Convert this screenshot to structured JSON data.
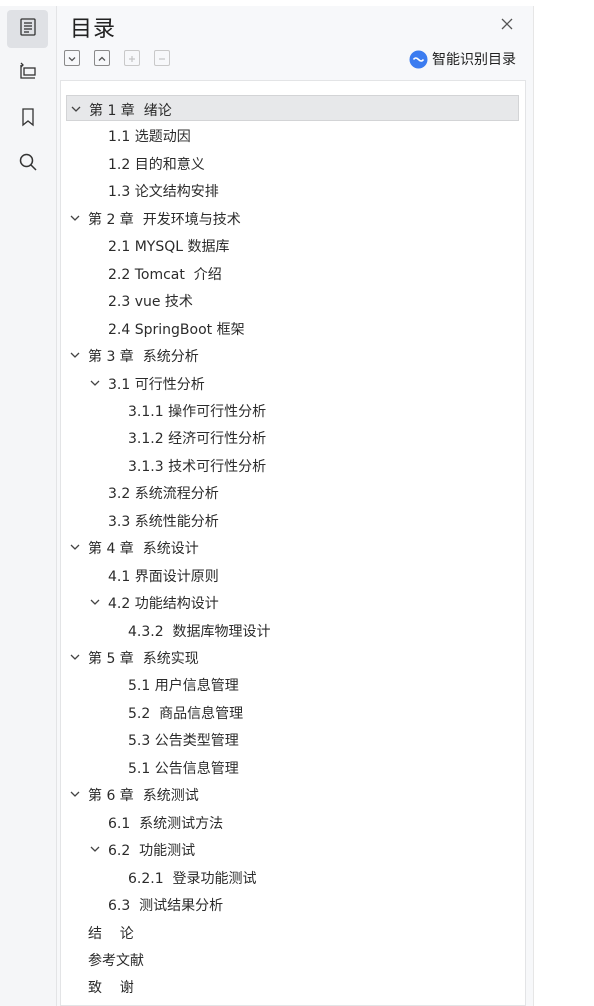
{
  "panel": {
    "title": "目录",
    "smart_button_label": "智能识别目录"
  },
  "rail": {
    "items": [
      {
        "icon": "outline-icon",
        "active": true
      },
      {
        "icon": "layers-icon",
        "active": false
      },
      {
        "icon": "bookmark-icon",
        "active": false
      },
      {
        "icon": "search-icon",
        "active": false
      }
    ]
  },
  "toolbar": {
    "buttons": [
      {
        "icon": "collapse-down-icon",
        "enabled": true
      },
      {
        "icon": "collapse-up-icon",
        "enabled": true
      },
      {
        "icon": "plus-icon",
        "enabled": false
      },
      {
        "icon": "minus-icon",
        "enabled": false
      }
    ]
  },
  "toc": {
    "items": [
      {
        "label": "第 1 章  绪论",
        "level": 1,
        "expanded": true,
        "selected": true
      },
      {
        "label": "1.1 选题动因",
        "level": 2
      },
      {
        "label": "1.2 目的和意义",
        "level": 2
      },
      {
        "label": "1.3 论文结构安排",
        "level": 2
      },
      {
        "label": "第 2 章  开发环境与技术",
        "level": 1,
        "expanded": true
      },
      {
        "label": "2.1 MYSQL 数据库",
        "level": 2
      },
      {
        "label": "2.2 Tomcat  介绍",
        "level": 2
      },
      {
        "label": "2.3 vue 技术",
        "level": 2
      },
      {
        "label": "2.4 SpringBoot 框架",
        "level": 2
      },
      {
        "label": "第 3 章  系统分析",
        "level": 1,
        "expanded": true
      },
      {
        "label": "3.1 可行性分析",
        "level": 2,
        "expanded": true
      },
      {
        "label": "3.1.1 操作可行性分析",
        "level": 3
      },
      {
        "label": "3.1.2 经济可行性分析",
        "level": 3
      },
      {
        "label": "3.1.3 技术可行性分析",
        "level": 3
      },
      {
        "label": "3.2 系统流程分析",
        "level": 2
      },
      {
        "label": "3.3 系统性能分析",
        "level": 2
      },
      {
        "label": "第 4 章  系统设计",
        "level": 1,
        "expanded": true
      },
      {
        "label": "4.1 界面设计原则",
        "level": 2
      },
      {
        "label": "4.2 功能结构设计",
        "level": 2,
        "expanded": true
      },
      {
        "label": "4.3.2  数据库物理设计",
        "level": 3
      },
      {
        "label": "第 5 章  系统实现",
        "level": 1,
        "expanded": true
      },
      {
        "label": "5.1 用户信息管理",
        "level": 3
      },
      {
        "label": "5.2  商品信息管理",
        "level": 3
      },
      {
        "label": "5.3 公告类型管理",
        "level": 3
      },
      {
        "label": "5.1 公告信息管理",
        "level": 3
      },
      {
        "label": "第 6 章  系统测试",
        "level": 1,
        "expanded": true
      },
      {
        "label": "6.1  系统测试方法",
        "level": 2
      },
      {
        "label": "6.2  功能测试",
        "level": 2,
        "expanded": true
      },
      {
        "label": "6.2.1  登录功能测试",
        "level": 3
      },
      {
        "label": "6.3  测试结果分析",
        "level": 2
      },
      {
        "label": "结    论",
        "level": 1
      },
      {
        "label": "参考文献",
        "level": 1
      },
      {
        "label": "致    谢",
        "level": 1
      }
    ]
  }
}
